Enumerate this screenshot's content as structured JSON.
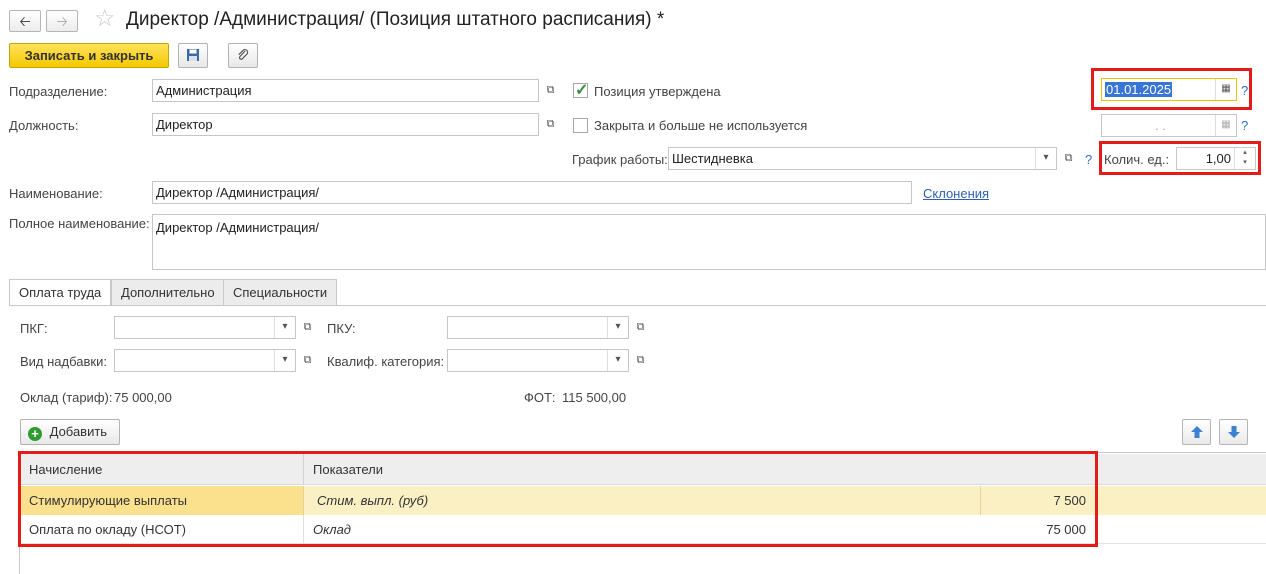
{
  "nav": {
    "back_label": "🡠",
    "forward_label": "🡢"
  },
  "window": {
    "title": "Директор /Администрация/ (Позиция штатного расписания) *"
  },
  "toolbar": {
    "save_close_label": "Записать и закрыть",
    "save_icon": "floppy-disk-icon",
    "attach_icon": "paperclip-icon"
  },
  "form": {
    "subdivision_label": "Подразделение:",
    "subdivision_value": "Администрация",
    "position_label": "Должность:",
    "position_value": "Директор",
    "approved_label": "Позиция утверждена",
    "approved_checked": true,
    "closed_label": "Закрыта и больше не используется",
    "closed_checked": false,
    "approval_date": "01.01.2025",
    "closed_date_placeholder": ". .",
    "schedule_label": "График работы:",
    "schedule_value": "Шестидневка",
    "units_label": "Колич. ед.:",
    "units_value": "1,00",
    "name_label": "Наименование:",
    "name_value": "Директор /Администрация/",
    "declensions_link": "Склонения",
    "full_name_label": "Полное наименование:",
    "full_name_value": "Директор /Администрация/",
    "help_mark": "?"
  },
  "tabs": [
    {
      "label": "Оплата труда",
      "active": true
    },
    {
      "label": "Дополнительно",
      "active": false
    },
    {
      "label": "Специальности",
      "active": false
    }
  ],
  "payment": {
    "pkg_label": "ПКГ:",
    "pku_label": "ПКУ:",
    "allowance_label": "Вид надбавки:",
    "qual_label": "Квалиф. категория:",
    "salary_label": "Оклад (тариф):",
    "salary_value": "75 000,00",
    "fot_label": "ФОТ:",
    "fot_value": "115 500,00",
    "add_label": "Добавить"
  },
  "grid": {
    "columns": [
      "Начисление",
      "Показатели"
    ],
    "rows": [
      {
        "accrual": "Стимулирующие выплаты",
        "indicator": "Стим. выпл. (руб)",
        "value": "7 500",
        "selected": true
      },
      {
        "accrual": "Оплата по окладу (НСОТ)",
        "indicator": "Оклад",
        "value": "75 000",
        "selected": false
      }
    ]
  },
  "colors": {
    "highlight_red": "#e31b1b",
    "row_selected": "#fbf0c4",
    "accent_yellow": "#f5c800"
  }
}
